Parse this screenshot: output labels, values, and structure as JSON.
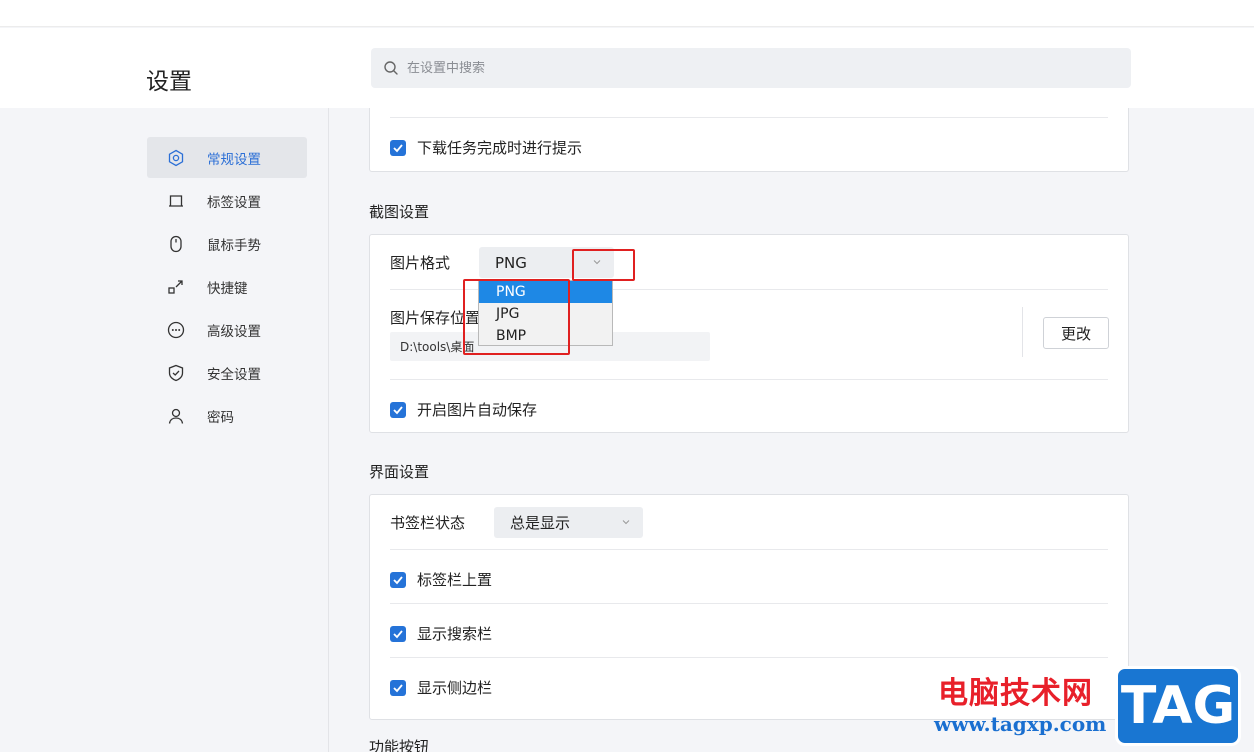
{
  "header": {
    "title": "设置",
    "search_placeholder": "在设置中搜索"
  },
  "sidebar": {
    "items": [
      {
        "label": "常规设置",
        "icon": "hexagon-settings-icon",
        "active": true
      },
      {
        "label": "标签设置",
        "icon": "tab-icon"
      },
      {
        "label": "鼠标手势",
        "icon": "mouse-icon"
      },
      {
        "label": "快捷键",
        "icon": "shortcut-arrow-icon"
      },
      {
        "label": "高级设置",
        "icon": "more-circle-icon"
      },
      {
        "label": "安全设置",
        "icon": "shield-icon"
      },
      {
        "label": "密码",
        "icon": "user-icon"
      }
    ]
  },
  "download": {
    "notify_label": "下载任务完成时进行提示"
  },
  "screenshot": {
    "section_title": "截图设置",
    "format_label": "图片格式",
    "format_value": "PNG",
    "format_options": [
      "PNG",
      "JPG",
      "BMP"
    ],
    "save_location_label": "图片保存位置",
    "save_path": "D:\\tools\\桌面",
    "change_button": "更改",
    "auto_save_label": "开启图片自动保存"
  },
  "interface": {
    "section_title": "界面设置",
    "bookmark_bar_label": "书签栏状态",
    "bookmark_bar_value": "总是显示",
    "tabbar_top_label": "标签栏上置",
    "show_search_label": "显示搜索栏",
    "show_sidebar_label": "显示侧边栏"
  },
  "function_buttons": {
    "section_title": "功能按钮"
  },
  "watermark": {
    "site_name": "电脑技术网",
    "url": "www.tagxp.com",
    "logo": "TAG"
  },
  "colors": {
    "accent": "#2573d8",
    "highlight_red": "#e02020",
    "dropdown_selected": "#1e88e5"
  }
}
